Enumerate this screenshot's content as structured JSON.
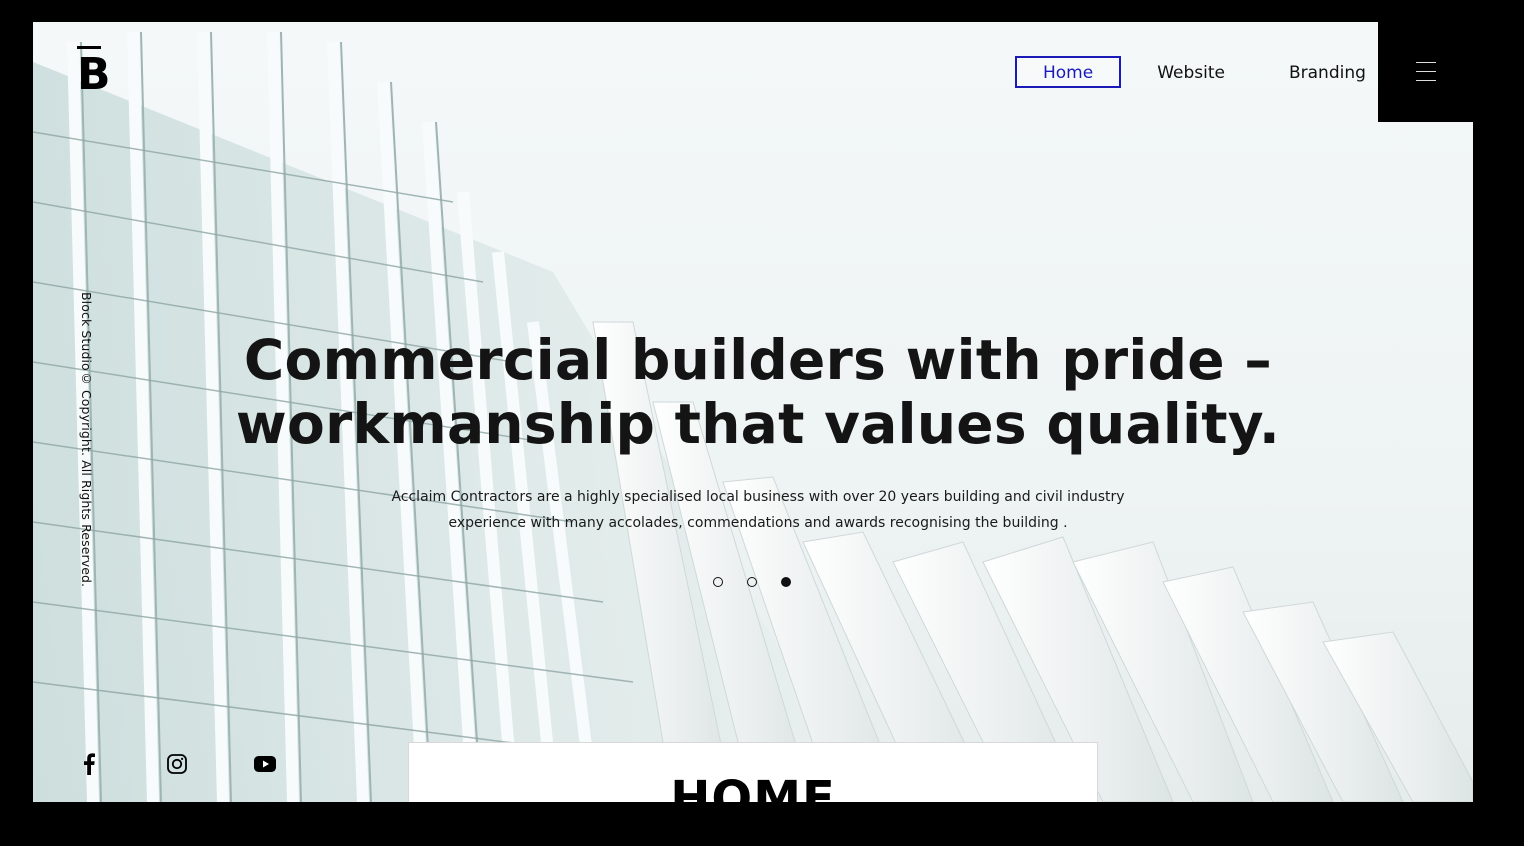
{
  "logo": {
    "letter": "B"
  },
  "nav": {
    "items": [
      {
        "label": "Home",
        "active": true
      },
      {
        "label": "Website",
        "active": false
      },
      {
        "label": "Branding",
        "active": false
      }
    ],
    "menu_icon": "hamburger-icon"
  },
  "copyright": "Block Studio© Copyright. All Rights Reserved.",
  "hero": {
    "title_line1": "Commercial builders with pride –",
    "title_line2": "workmanship that values quality.",
    "subtitle_line1": "Acclaim Contractors are a highly specialised local business with over 20 years building and civil industry",
    "subtitle_line2": "experience with many accolades, commendations and awards recognising the building .",
    "slides": 3,
    "active_slide": 3
  },
  "social": {
    "icons": [
      "facebook-icon",
      "instagram-icon",
      "youtube-icon"
    ]
  },
  "card": {
    "title": "HOME"
  },
  "colors": {
    "accent": "#1a1ab8",
    "text": "#141414",
    "menu_bg": "#000000"
  }
}
